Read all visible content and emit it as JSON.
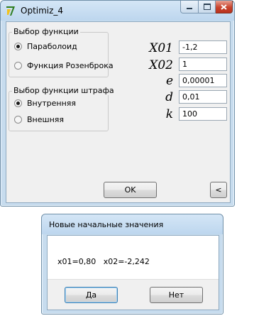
{
  "main_window": {
    "title": "Optimiz_4",
    "controls": {
      "minimize": "—",
      "maximize": "☐",
      "close": "✕"
    },
    "function_group": {
      "legend": "Выбор функции",
      "options": [
        {
          "label": "Параболоид",
          "selected": true
        },
        {
          "label": "Функция Розенброка",
          "selected": false
        }
      ]
    },
    "penalty_group": {
      "legend": "Выбор функции штрафа",
      "options": [
        {
          "label": "Внутренняя",
          "selected": true
        },
        {
          "label": "Внешняя",
          "selected": false
        }
      ]
    },
    "params": [
      {
        "label": "X01",
        "value": "-1,2"
      },
      {
        "label": "X02",
        "value": "1"
      },
      {
        "label": "e",
        "value": "0,00001"
      },
      {
        "label": "d",
        "value": "0,01"
      },
      {
        "label": "k",
        "value": "100"
      }
    ],
    "ok_label": "OK",
    "back_label": "<"
  },
  "dialog": {
    "title": "Новые начальные значения",
    "message": "x01=0,80   x02=-2,242",
    "yes_label": "Да",
    "no_label": "Нет"
  },
  "colors": {
    "frame": "#c7dcee",
    "client": "#f0f0f0",
    "close_button": "#c9432d",
    "app_icon": "#2e7d1f"
  },
  "icons": {
    "app": "delphi-app-icon",
    "radio_selected": "radio-checked-icon",
    "radio_unselected": "radio-unchecked-icon"
  }
}
